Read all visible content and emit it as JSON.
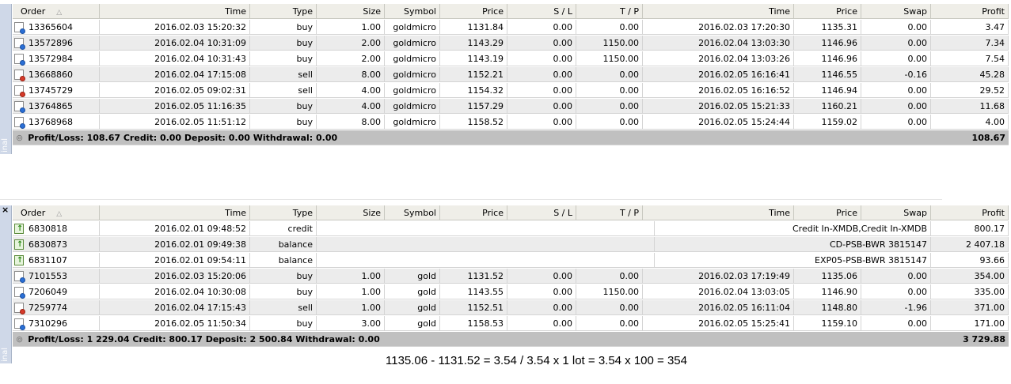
{
  "colors": {
    "header_bg": "#efeee8",
    "alt_row_bg": "#ececec",
    "summary_bg": "#c0c0c0",
    "side_bar": "#cfd8e8"
  },
  "columns": [
    "Order",
    "Time",
    "Type",
    "Size",
    "Symbol",
    "Price",
    "S / L",
    "T / P",
    "Time",
    "Price",
    "Swap",
    "Profit"
  ],
  "panel1": {
    "side_label": "inal",
    "close_glyph": "",
    "rows": [
      {
        "order": "13365604",
        "time": "2016.02.03 15:20:32",
        "type": "buy",
        "size": "1.00",
        "symbol": "goldmicro",
        "price": "1131.84",
        "sl": "0.00",
        "tp": "0.00",
        "ctime": "2016.02.03 17:20:30",
        "cprice": "1135.31",
        "swap": "0.00",
        "profit": "3.47",
        "icon": "blue-doc-icon"
      },
      {
        "order": "13572896",
        "time": "2016.02.04 10:31:09",
        "type": "buy",
        "size": "2.00",
        "symbol": "goldmicro",
        "price": "1143.29",
        "sl": "0.00",
        "tp": "1150.00",
        "ctime": "2016.02.04 13:03:30",
        "cprice": "1146.96",
        "swap": "0.00",
        "profit": "7.34",
        "icon": "blue-doc-icon"
      },
      {
        "order": "13572984",
        "time": "2016.02.04 10:31:43",
        "type": "buy",
        "size": "2.00",
        "symbol": "goldmicro",
        "price": "1143.19",
        "sl": "0.00",
        "tp": "1150.00",
        "ctime": "2016.02.04 13:03:26",
        "cprice": "1146.96",
        "swap": "0.00",
        "profit": "7.54",
        "icon": "blue-doc-icon"
      },
      {
        "order": "13668860",
        "time": "2016.02.04 17:15:08",
        "type": "sell",
        "size": "8.00",
        "symbol": "goldmicro",
        "price": "1152.21",
        "sl": "0.00",
        "tp": "0.00",
        "ctime": "2016.02.05 16:16:41",
        "cprice": "1146.55",
        "swap": "-0.16",
        "profit": "45.28",
        "icon": "red-doc-icon"
      },
      {
        "order": "13745729",
        "time": "2016.02.05 09:02:31",
        "type": "sell",
        "size": "4.00",
        "symbol": "goldmicro",
        "price": "1154.32",
        "sl": "0.00",
        "tp": "0.00",
        "ctime": "2016.02.05 16:16:52",
        "cprice": "1146.94",
        "swap": "0.00",
        "profit": "29.52",
        "icon": "red-doc-icon"
      },
      {
        "order": "13764865",
        "time": "2016.02.05 11:16:35",
        "type": "buy",
        "size": "4.00",
        "symbol": "goldmicro",
        "price": "1157.29",
        "sl": "0.00",
        "tp": "0.00",
        "ctime": "2016.02.05 15:21:33",
        "cprice": "1160.21",
        "swap": "0.00",
        "profit": "11.68",
        "icon": "blue-doc-icon"
      },
      {
        "order": "13768968",
        "time": "2016.02.05 11:51:12",
        "type": "buy",
        "size": "8.00",
        "symbol": "goldmicro",
        "price": "1158.52",
        "sl": "0.00",
        "tp": "0.00",
        "ctime": "2016.02.05 15:24:44",
        "cprice": "1159.02",
        "swap": "0.00",
        "profit": "4.00",
        "icon": "blue-doc-icon"
      }
    ],
    "summary_text": "Profit/Loss: 108.67  Credit: 0.00  Deposit: 0.00  Withdrawal: 0.00",
    "summary_total": "108.67"
  },
  "panel2": {
    "side_label": "inal",
    "close_glyph": "×",
    "rows": [
      {
        "order": "6830818",
        "time": "2016.02.01 09:48:52",
        "type": "credit",
        "comment": "Credit In-XMDB,Credit In-XMDB",
        "profit": "800.17",
        "icon": "green-arrow-icon"
      },
      {
        "order": "6830873",
        "time": "2016.02.01 09:49:38",
        "type": "balance",
        "comment": "CD-PSB-BWR 3815147",
        "profit": "2 407.18",
        "icon": "green-arrow-icon"
      },
      {
        "order": "6831107",
        "time": "2016.02.01 09:54:11",
        "type": "balance",
        "comment": "EXP05-PSB-BWR 3815147",
        "profit": "93.66",
        "icon": "green-arrow-icon"
      },
      {
        "order": "7101553",
        "time": "2016.02.03 15:20:06",
        "type": "buy",
        "size": "1.00",
        "symbol": "gold",
        "price": "1131.52",
        "sl": "0.00",
        "tp": "0.00",
        "ctime": "2016.02.03 17:19:49",
        "cprice": "1135.06",
        "swap": "0.00",
        "profit": "354.00",
        "icon": "blue-doc-icon"
      },
      {
        "order": "7206049",
        "time": "2016.02.04 10:30:08",
        "type": "buy",
        "size": "1.00",
        "symbol": "gold",
        "price": "1143.55",
        "sl": "0.00",
        "tp": "1150.00",
        "ctime": "2016.02.04 13:03:05",
        "cprice": "1146.90",
        "swap": "0.00",
        "profit": "335.00",
        "icon": "blue-doc-icon"
      },
      {
        "order": "7259774",
        "time": "2016.02.04 17:15:43",
        "type": "sell",
        "size": "1.00",
        "symbol": "gold",
        "price": "1152.51",
        "sl": "0.00",
        "tp": "0.00",
        "ctime": "2016.02.05 16:11:04",
        "cprice": "1148.80",
        "swap": "-1.96",
        "profit": "371.00",
        "icon": "red-doc-icon"
      },
      {
        "order": "7310296",
        "time": "2016.02.05 11:50:34",
        "type": "buy",
        "size": "3.00",
        "symbol": "gold",
        "price": "1158.53",
        "sl": "0.00",
        "tp": "0.00",
        "ctime": "2016.02.05 15:25:41",
        "cprice": "1159.10",
        "swap": "0.00",
        "profit": "171.00",
        "icon": "blue-doc-icon"
      }
    ],
    "summary_text": "Profit/Loss: 1 229.04  Credit: 800.17  Deposit: 2 500.84  Withdrawal: 0.00",
    "summary_total": "3 729.88"
  },
  "formula": "1135.06 - 1131.52 = 3.54  / 3.54 x 1 lot = 3.54 x 100 = 354"
}
